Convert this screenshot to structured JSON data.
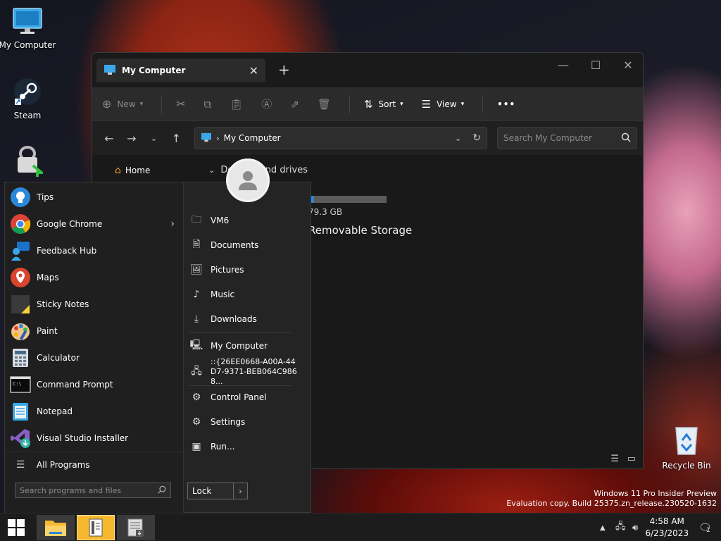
{
  "desktop": {
    "icons": [
      {
        "label": "My Computer",
        "icon": "monitor-icon"
      },
      {
        "label": "Steam",
        "icon": "steam-icon"
      },
      {
        "label": "",
        "icon": "lock-shortcut-icon"
      },
      {
        "label": "Recycle Bin",
        "icon": "recycle-bin-icon"
      }
    ]
  },
  "explorer": {
    "tab_title": "My Computer",
    "toolbar": {
      "new_label": "New",
      "sort_label": "Sort",
      "view_label": "View",
      "more_label": "•••"
    },
    "address": {
      "path": "My Computer"
    },
    "search": {
      "placeholder": "Search My Computer"
    },
    "nav": {
      "home_label": "Home"
    },
    "group_header": "Devices and drives",
    "drive": {
      "size_text": "79.3 GB",
      "used_fraction": 0.06
    },
    "removable_label": "Removable Storage"
  },
  "start_menu": {
    "programs": [
      {
        "label": "Tips",
        "icon": "tips-icon"
      },
      {
        "label": "Google Chrome",
        "icon": "chrome-icon",
        "has_submenu": true
      },
      {
        "label": "Feedback Hub",
        "icon": "feedback-hub-icon"
      },
      {
        "label": "Maps",
        "icon": "maps-icon"
      },
      {
        "label": "Sticky Notes",
        "icon": "sticky-notes-icon"
      },
      {
        "label": "Paint",
        "icon": "paint-icon"
      },
      {
        "label": "Calculator",
        "icon": "calculator-icon"
      },
      {
        "label": "Command Prompt",
        "icon": "command-prompt-icon"
      },
      {
        "label": "Notepad",
        "icon": "notepad-icon"
      },
      {
        "label": "Visual Studio Installer",
        "icon": "visual-studio-installer-icon"
      }
    ],
    "all_programs_label": "All Programs",
    "search_placeholder": "Search programs and files",
    "places": [
      {
        "label": "VM6",
        "icon": "user-folder-icon"
      },
      {
        "label": "Documents",
        "icon": "document-icon"
      },
      {
        "label": "Pictures",
        "icon": "picture-icon"
      },
      {
        "label": "Music",
        "icon": "music-icon"
      },
      {
        "label": "Downloads",
        "icon": "download-icon"
      },
      {
        "label": "My Computer",
        "icon": "computer-icon"
      },
      {
        "label": "::{26EE0668-A00A-44D7-9371-BEB064C9868...",
        "icon": "network-computer-icon"
      },
      {
        "label": "Control Panel",
        "icon": "control-panel-icon"
      },
      {
        "label": "Settings",
        "icon": "gear-icon"
      },
      {
        "label": "Run...",
        "icon": "run-icon"
      }
    ],
    "lock_label": "Lock"
  },
  "watermark": {
    "line1": "Windows 11 Pro Insider Preview",
    "line2": "Evaluation copy. Build 25375.zn_release.230520-1632"
  },
  "taskbar": {
    "apps": [
      "start-button",
      "file-explorer",
      "app-with-book",
      "app-window"
    ],
    "clock": {
      "time": "4:58 AM",
      "date": "6/23/2023"
    },
    "notification_count": "1"
  },
  "colors": {
    "accent": "#2b88d8",
    "window_bg": "#202020",
    "taskbar_bg": "#1c1c1c"
  }
}
